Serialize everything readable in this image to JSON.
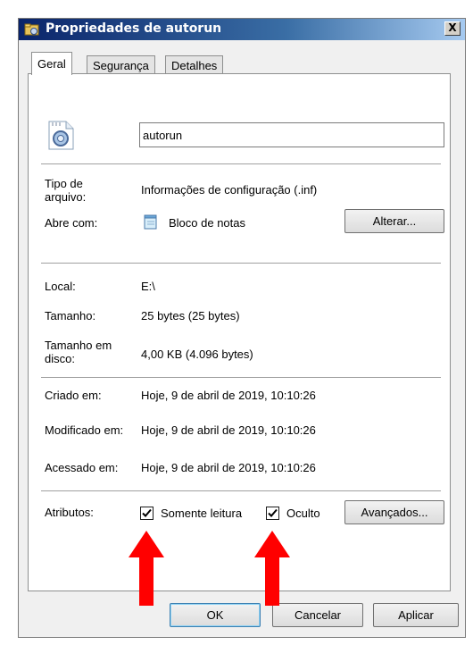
{
  "window": {
    "title": "Propriedades de autorun",
    "close_glyph": "X"
  },
  "tabs": [
    {
      "label": "Geral",
      "active": true
    },
    {
      "label": "Segurança",
      "active": false
    },
    {
      "label": "Detalhes",
      "active": false
    }
  ],
  "general": {
    "file_icon": "settings-file-icon",
    "filename": "autorun",
    "file_type_label": "Tipo de arquivo:",
    "file_type_value": "Informações de configuração (.inf)",
    "opens_with_label": "Abre com:",
    "opens_with_value": "Bloco de notas",
    "opens_with_icon": "notepad-icon",
    "change_button": "Alterar...",
    "location_label": "Local:",
    "location_value": "E:\\",
    "size_label": "Tamanho:",
    "size_value": "25 bytes (25 bytes)",
    "size_on_disk_label": "Tamanho em disco:",
    "size_on_disk_value": "4,00 KB (4.096 bytes)",
    "created_label": "Criado em:",
    "created_value": "Hoje, 9 de abril de 2019, 10:10:26",
    "modified_label": "Modificado em:",
    "modified_value": "Hoje, 9 de abril de 2019, 10:10:26",
    "accessed_label": "Acessado em:",
    "accessed_value": "Hoje, 9 de abril de 2019, 10:10:26",
    "attributes_label": "Atributos:",
    "readonly_label": "Somente leitura",
    "readonly_checked": true,
    "hidden_label": "Oculto",
    "hidden_checked": true,
    "advanced_button": "Avançados..."
  },
  "footer": {
    "ok": "OK",
    "cancel": "Cancelar",
    "apply": "Aplicar"
  },
  "annotation": {
    "arrow_color": "#ff0000"
  },
  "colors": {
    "titlebar": "#0a246a",
    "panel": "#ffffff",
    "window": "#f0f0f0"
  }
}
